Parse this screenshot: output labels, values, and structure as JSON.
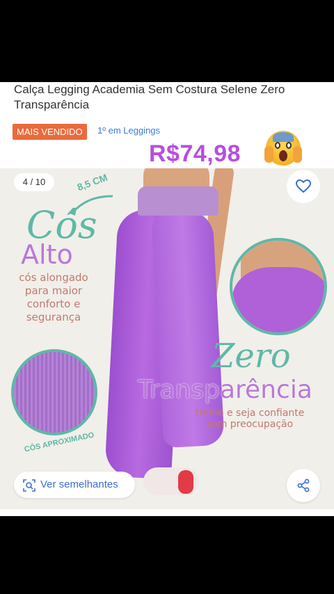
{
  "product": {
    "title": "Calça Legging Academia Sem Costura Selene Zero Transparência",
    "badge": "MAIS VENDIDO",
    "rank": "1º em Leggings",
    "price_overlay": "R$74,98"
  },
  "gallery": {
    "counter": "4 / 10",
    "measure": "8,5 CM",
    "cos_script": "Cós",
    "alto": "Alto",
    "cos_desc": "cós alongado para maior conforto e segurança",
    "cos_aprox": "CÓS APROXIMADO",
    "zero_script": "Zero",
    "transparencia": "Transparência",
    "transp_desc": "treine e seja confiante sem preocupação"
  },
  "actions": {
    "similar_label": "Ver semelhantes"
  },
  "icons": {
    "favorite": "heart-icon",
    "similar": "visual-search-icon",
    "share": "share-icon",
    "emoji": "screaming-face-emoji"
  },
  "colors": {
    "badge": "#ea6b3c",
    "link": "#3b7bd6",
    "price": "#b84de0",
    "teal": "#5fb8a8",
    "lilac": "#b978d9"
  }
}
